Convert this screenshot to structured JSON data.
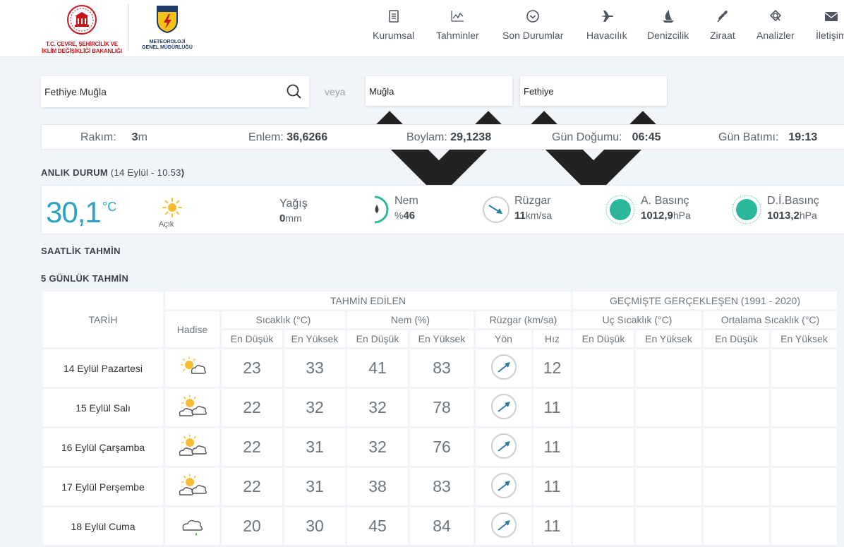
{
  "header": {
    "logo1_text_line1": "T.C. ÇEVRE, ŞEHİRCİLİK VE",
    "logo1_text_line2": "İKLİM DEĞİŞİKLİĞİ BAKANLIĞI",
    "logo2_text_line1": "METEOROLOJİ",
    "logo2_text_line2": "GENEL MÜDÜRLÜĞÜ",
    "nav": [
      {
        "label": "Kurumsal",
        "icon": "document-icon"
      },
      {
        "label": "Tahminler",
        "icon": "chart-icon"
      },
      {
        "label": "Son Durumlar",
        "icon": "clock-down-icon"
      },
      {
        "label": "Havacılık",
        "icon": "plane-icon"
      },
      {
        "label": "Denizcilik",
        "icon": "sailboat-icon"
      },
      {
        "label": "Ziraat",
        "icon": "wheat-icon"
      },
      {
        "label": "Analizler",
        "icon": "analysis-icon"
      },
      {
        "label": "İletişim",
        "icon": "mail-icon"
      }
    ]
  },
  "search": {
    "value": "Fethiye Muğla",
    "veya": "veya",
    "province": "Muğla",
    "district": "Fethiye"
  },
  "info": {
    "rakim_label": "Rakım:",
    "rakim_value": "3",
    "rakim_unit": "m",
    "enlem_label": "Enlem:",
    "enlem_value": "36,6266",
    "boylam_label": "Boylam:",
    "boylam_value": "29,1238",
    "dogum_label": "Gün Doğumu:",
    "dogum_value": "06:45",
    "batim_label": "Gün Batımı:",
    "batim_value": "19:13"
  },
  "current": {
    "title": "ANLIK DURUM",
    "title_open": " (",
    "title_date": "14 Eylül - 10.53",
    "title_close": ")",
    "temp": "30,1",
    "temp_unit": "°C",
    "condition": "Açık",
    "yagis_label": "Yağış",
    "yagis_value": "0",
    "yagis_unit": "mm",
    "nem_label": "Nem",
    "nem_prefix": "%",
    "nem_value": "46",
    "ruzgar_label": "Rüzgar",
    "ruzgar_value": "11",
    "ruzgar_unit": "km/sa",
    "basinc_label": "A. Basınç",
    "basinc_value": "1012,9",
    "basinc_unit": "hPa",
    "dibasinc_label": "D.İ.Basınç",
    "dibasinc_value": "1013,2",
    "dibasinc_unit": "hPa",
    "colors": {
      "accent": "#2ba3c4",
      "gauge": "#2bb79a"
    }
  },
  "hourly_title": "SAATLİK TAHMİN",
  "forecast": {
    "title": "5 GÜNLÜK TAHMİN",
    "headers": {
      "tarih": "TARİH",
      "tahmin_edilen": "TAHMİN EDİLEN",
      "gecmiste": "GEÇMİŞTE GERÇEKLEŞEN (1991 - 2020)",
      "hadise": "Hadise",
      "sicaklik": "Sıcaklık (°C)",
      "nem": "Nem (%)",
      "ruzgar": "Rüzgar (km/sa)",
      "uc_sicaklik": "Uç Sıcaklık (°C)",
      "ortalama_sicaklik": "Ortalama Sıcaklık (°C)",
      "en_dusuk": "En Düşük",
      "en_yuksek": "En Yüksek",
      "yon": "Yön",
      "hiz": "Hız"
    },
    "rows": [
      {
        "date": "14 Eylül Pazartesi",
        "icon": "sun-cloud-icon",
        "t_min": "23",
        "t_max": "33",
        "h_min": "41",
        "h_max": "83",
        "wind": "12"
      },
      {
        "date": "15 Eylül Salı",
        "icon": "sun-clouds-icon",
        "t_min": "22",
        "t_max": "32",
        "h_min": "32",
        "h_max": "78",
        "wind": "11"
      },
      {
        "date": "16 Eylül Çarşamba",
        "icon": "sun-clouds-icon",
        "t_min": "22",
        "t_max": "31",
        "h_min": "32",
        "h_max": "76",
        "wind": "11"
      },
      {
        "date": "17 Eylül Perşembe",
        "icon": "sun-clouds-icon",
        "t_min": "22",
        "t_max": "31",
        "h_min": "38",
        "h_max": "83",
        "wind": "11"
      },
      {
        "date": "18 Eylül Cuma",
        "icon": "cloud-rain-icon",
        "t_min": "20",
        "t_max": "30",
        "h_min": "45",
        "h_max": "84",
        "wind": "11"
      }
    ]
  }
}
